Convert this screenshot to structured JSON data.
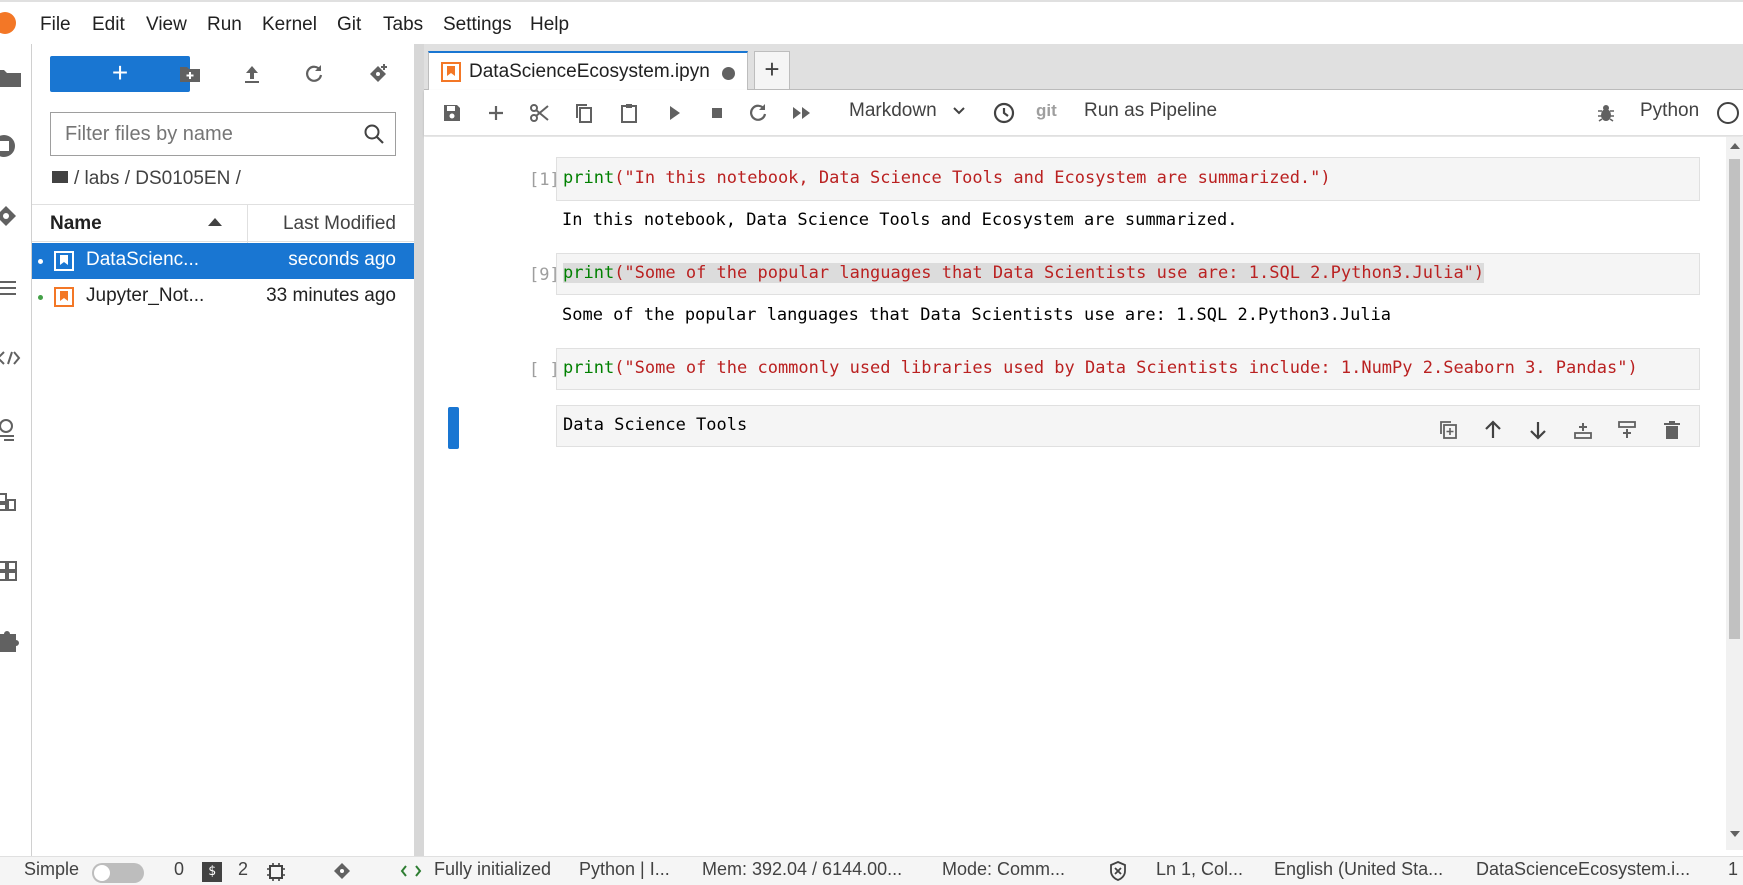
{
  "menubar": {
    "items": [
      "File",
      "Edit",
      "View",
      "Run",
      "Kernel",
      "Git",
      "Tabs",
      "Settings",
      "Help"
    ]
  },
  "filebrowser": {
    "new_label": "+",
    "filter_placeholder": "Filter files by name",
    "breadcrumb": "/ labs / DS0105EN /",
    "columns": {
      "name": "Name",
      "modified": "Last Modified"
    },
    "files": [
      {
        "name": "DataScienc...",
        "modified": "seconds ago",
        "selected": true
      },
      {
        "name": "Jupyter_Not...",
        "modified": "33 minutes ago",
        "selected": false
      }
    ]
  },
  "tabs": {
    "active_title": "DataScienceEcosystem.ipyn",
    "add_label": "+"
  },
  "toolbar": {
    "cell_type": "Markdown",
    "git_label": "git",
    "run_pipeline": "Run as Pipeline",
    "kernel": "Python"
  },
  "cells": [
    {
      "prompt": "[1]:",
      "code_kw": "print",
      "code_str": "(\"In this notebook, Data Science Tools and Ecosystem are summarized.\")",
      "output": "In this notebook, Data Science Tools and Ecosystem are summarized."
    },
    {
      "prompt": "[9]:",
      "code_kw": "print",
      "code_str": "(\"Some of the popular languages that Data Scientists use are: 1.SQL 2.Python3.Julia\")",
      "output": "Some of the popular languages that Data Scientists use are: 1.SQL 2.Python3.Julia"
    },
    {
      "prompt": "[ ]:",
      "code_kw": "print",
      "code_str": "(\"Some of the commonly used libraries used by Data Scientists include: 1.NumPy 2.Seaborn 3. Pandas\")",
      "output": ""
    },
    {
      "prompt": "",
      "markdown": "Data Science Tools"
    }
  ],
  "statusbar": {
    "simple": "Simple",
    "terminals": "0",
    "kernels": "2",
    "init": "Fully initialized",
    "kernel": "Python | I...",
    "mem": "Mem: 392.04 / 6144.00...",
    "mode": "Mode: Comm...",
    "position": "Ln 1, Col...",
    "language": "English (United Sta...",
    "file": "DataScienceEcosystem.i...",
    "last": "1"
  },
  "colors": {
    "accent": "#1976d2",
    "notebook_icon": "#f37726",
    "string": "#ba2121",
    "keyword": "#008000"
  }
}
